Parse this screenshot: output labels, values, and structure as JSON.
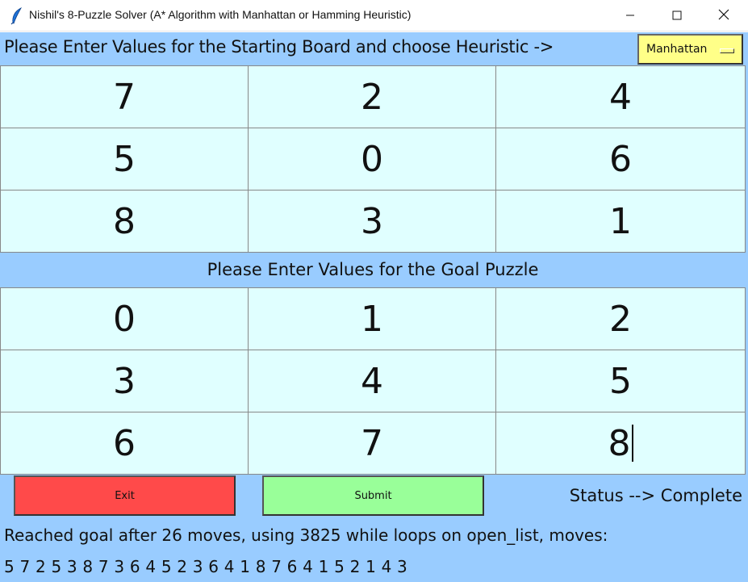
{
  "window": {
    "title": "Nishil's 8-Puzzle Solver (A* Algorithm with Manhattan or Hamming Heuristic)",
    "icon": "feather-icon",
    "controls": [
      "minimize-icon",
      "maximize-icon",
      "close-icon"
    ]
  },
  "header": {
    "prompt": "Please Enter Values for the Starting Board and choose Heuristic ->",
    "heuristic_selected": "Manhattan"
  },
  "start_board": [
    "7",
    "2",
    "4",
    "5",
    "0",
    "6",
    "8",
    "3",
    "1"
  ],
  "goal_label": "Please Enter Values for the Goal Puzzle",
  "goal_board": [
    "0",
    "1",
    "2",
    "3",
    "4",
    "5",
    "6",
    "7",
    "8"
  ],
  "buttons": {
    "exit": "Exit",
    "submit": "Submit"
  },
  "status": "Status --> Complete",
  "result": "Reached goal after 26 moves, using 3825 while loops on open_list, moves:",
  "moves": "5 7 2 5 3 8 7 3 6 4 5 2 3 6 4 1 8 7 6 4 1 5 2 1 4 3",
  "colors": {
    "background": "#99ccff",
    "cell": "#e0ffff",
    "select": "#ffff88",
    "exit": "#ff4a4a",
    "submit": "#99ff99"
  }
}
